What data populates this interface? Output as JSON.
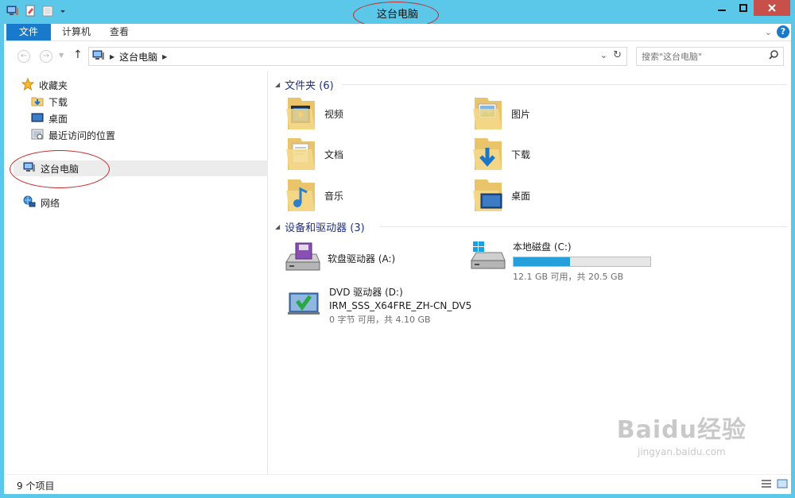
{
  "window": {
    "title": "这台电脑"
  },
  "ribbon": {
    "tabs": [
      "文件",
      "计算机",
      "查看"
    ]
  },
  "address": {
    "crumbs": [
      "这台电脑"
    ]
  },
  "search": {
    "placeholder": "搜索\"这台电脑\""
  },
  "nav": {
    "favorites_label": "收藏夹",
    "favorites": [
      "下载",
      "桌面",
      "最近访问的位置"
    ],
    "this_pc": "这台电脑",
    "network": "网络"
  },
  "folders": {
    "header": "文件夹 (6)",
    "items": [
      {
        "label": "视频",
        "icon": "video-folder-icon"
      },
      {
        "label": "图片",
        "icon": "pictures-folder-icon"
      },
      {
        "label": "文档",
        "icon": "documents-folder-icon"
      },
      {
        "label": "下载",
        "icon": "downloads-folder-icon"
      },
      {
        "label": "音乐",
        "icon": "music-folder-icon"
      },
      {
        "label": "桌面",
        "icon": "desktop-folder-icon"
      }
    ]
  },
  "devices": {
    "header": "设备和驱动器 (3)",
    "floppy": {
      "name": "软盘驱动器 (A:)"
    },
    "local_disk": {
      "name": "本地磁盘 (C:)",
      "used_fraction": 0.41,
      "free": "12.1 GB 可用，共 20.5 GB"
    },
    "dvd": {
      "name": "DVD 驱动器 (D:)",
      "label": "IRM_SSS_X64FRE_ZH-CN_DV5",
      "free": "0 字节 可用，共 4.10 GB"
    }
  },
  "status": {
    "count": "9 个项目"
  },
  "watermark": {
    "brand": "Baidu经验",
    "url": "jingyan.baidu.com"
  },
  "colors": {
    "accent": "#1979ca",
    "titlebar": "#5bc8ea",
    "bar_fill": "#26a0da",
    "annotation": "#c62828"
  }
}
